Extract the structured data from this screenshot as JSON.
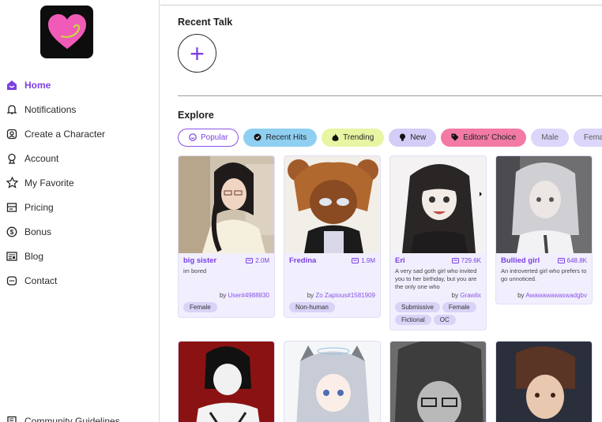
{
  "sidebar": {
    "items": [
      {
        "label": "Home",
        "icon": "home-icon",
        "active": true
      },
      {
        "label": "Notifications",
        "icon": "bell-icon"
      },
      {
        "label": "Create a Character",
        "icon": "create-character-icon"
      },
      {
        "label": "Account",
        "icon": "account-icon"
      },
      {
        "label": "My Favorite",
        "icon": "star-icon"
      },
      {
        "label": "Pricing",
        "icon": "pricing-icon"
      },
      {
        "label": "Bonus",
        "icon": "dollar-icon"
      },
      {
        "label": "Blog",
        "icon": "blog-icon"
      },
      {
        "label": "Contact",
        "icon": "contact-icon"
      }
    ],
    "guidelines": {
      "label": "Community Guidelines",
      "icon": "guidelines-icon"
    }
  },
  "main": {
    "recent_title": "Recent Talk",
    "add_symbol": "+",
    "explore_title": "Explore",
    "chips": [
      {
        "label": "Popular",
        "icon": "popular-icon"
      },
      {
        "label": "Recent Hits",
        "icon": "recent-hits-icon"
      },
      {
        "label": "Trending",
        "icon": "flame-icon"
      },
      {
        "label": "New",
        "icon": "new-icon"
      },
      {
        "label": "Editors' Choice",
        "icon": "tag-icon"
      },
      {
        "label": "Male"
      },
      {
        "label": "Female"
      }
    ],
    "cards": [
      {
        "name": "big sister",
        "count": "2.0M",
        "desc": "im bored",
        "by": "by ",
        "user": "User#4988830",
        "tags": [
          "Female"
        ]
      },
      {
        "name": "Fredina",
        "count": "1.9M",
        "desc": "",
        "by": "by ",
        "user": "Zo Zapious#1581909",
        "tags": [
          "Non-human"
        ]
      },
      {
        "name": "Eri",
        "count": "729.6K",
        "desc": "A very sad goth girl who invited you to her birthday, but you are the only one who",
        "by": "by ",
        "user": "Grawlix",
        "tags": [
          "Submissive",
          "Female",
          "Fictional",
          "OC"
        ]
      },
      {
        "name": "Bullied girl",
        "count": "648.8K",
        "desc": "An introverted girl who prefers to go unnoticed.",
        "by": "by ",
        "user": "Awawawawaswadgbv",
        "tags": []
      }
    ]
  },
  "colors": {
    "accent": "#7b3fe4",
    "card_bg": "#f1effd"
  }
}
